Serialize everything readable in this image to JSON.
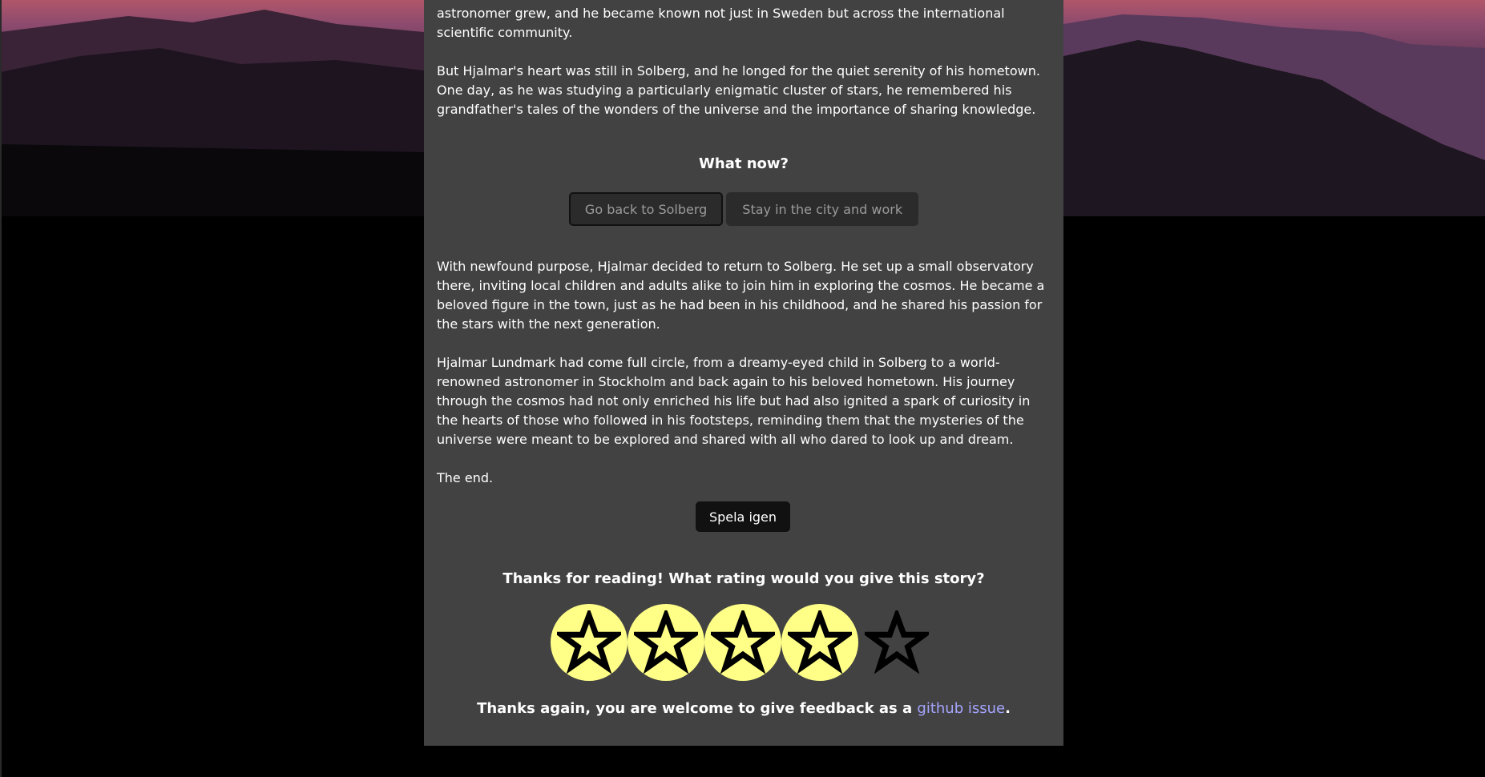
{
  "story": {
    "paragraph_1": "astronomer grew, and he became known not just in Sweden but across the international scientific community.",
    "paragraph_2": "But Hjalmar's heart was still in Solberg, and he longed for the quiet serenity of his hometown. One day, as he was studying a particularly enigmatic cluster of stars, he remembered his grandfather's tales of the wonders of the universe and the importance of sharing knowledge.",
    "paragraph_3": "With newfound purpose, Hjalmar decided to return to Solberg. He set up a small observatory there, inviting local children and adults alike to join him in exploring the cosmos. He became a beloved figure in the town, just as he had been in his childhood, and he shared his passion for the stars with the next generation.",
    "paragraph_4": "Hjalmar Lundmark had come full circle, from a dreamy-eyed child in Solberg to a world-renowned astronomer in Stockholm and back again to his beloved hometown. His journey through the cosmos had not only enriched his life but had also ignited a spark of curiosity in the hearts of those who followed in his footsteps, reminding them that the mysteries of the universe were meant to be explored and shared with all who dared to look up and dream.",
    "ending": "The end."
  },
  "choice_prompt": "What now?",
  "choices": [
    {
      "label": "Go back to Solberg",
      "selected": true
    },
    {
      "label": "Stay in the city and work",
      "selected": false
    }
  ],
  "play_again_label": "Spela igen",
  "rating": {
    "prompt": "Thanks for reading! What rating would you give this story?",
    "value": 4,
    "max": 5,
    "filled_color": "#ffff88"
  },
  "feedback": {
    "text": "Thanks again, you are welcome to give feedback as a ",
    "link_label": "github issue",
    "suffix": "."
  },
  "colors": {
    "panel": "#424242",
    "button_dark": "#111111",
    "link": "#a5a5ff"
  }
}
